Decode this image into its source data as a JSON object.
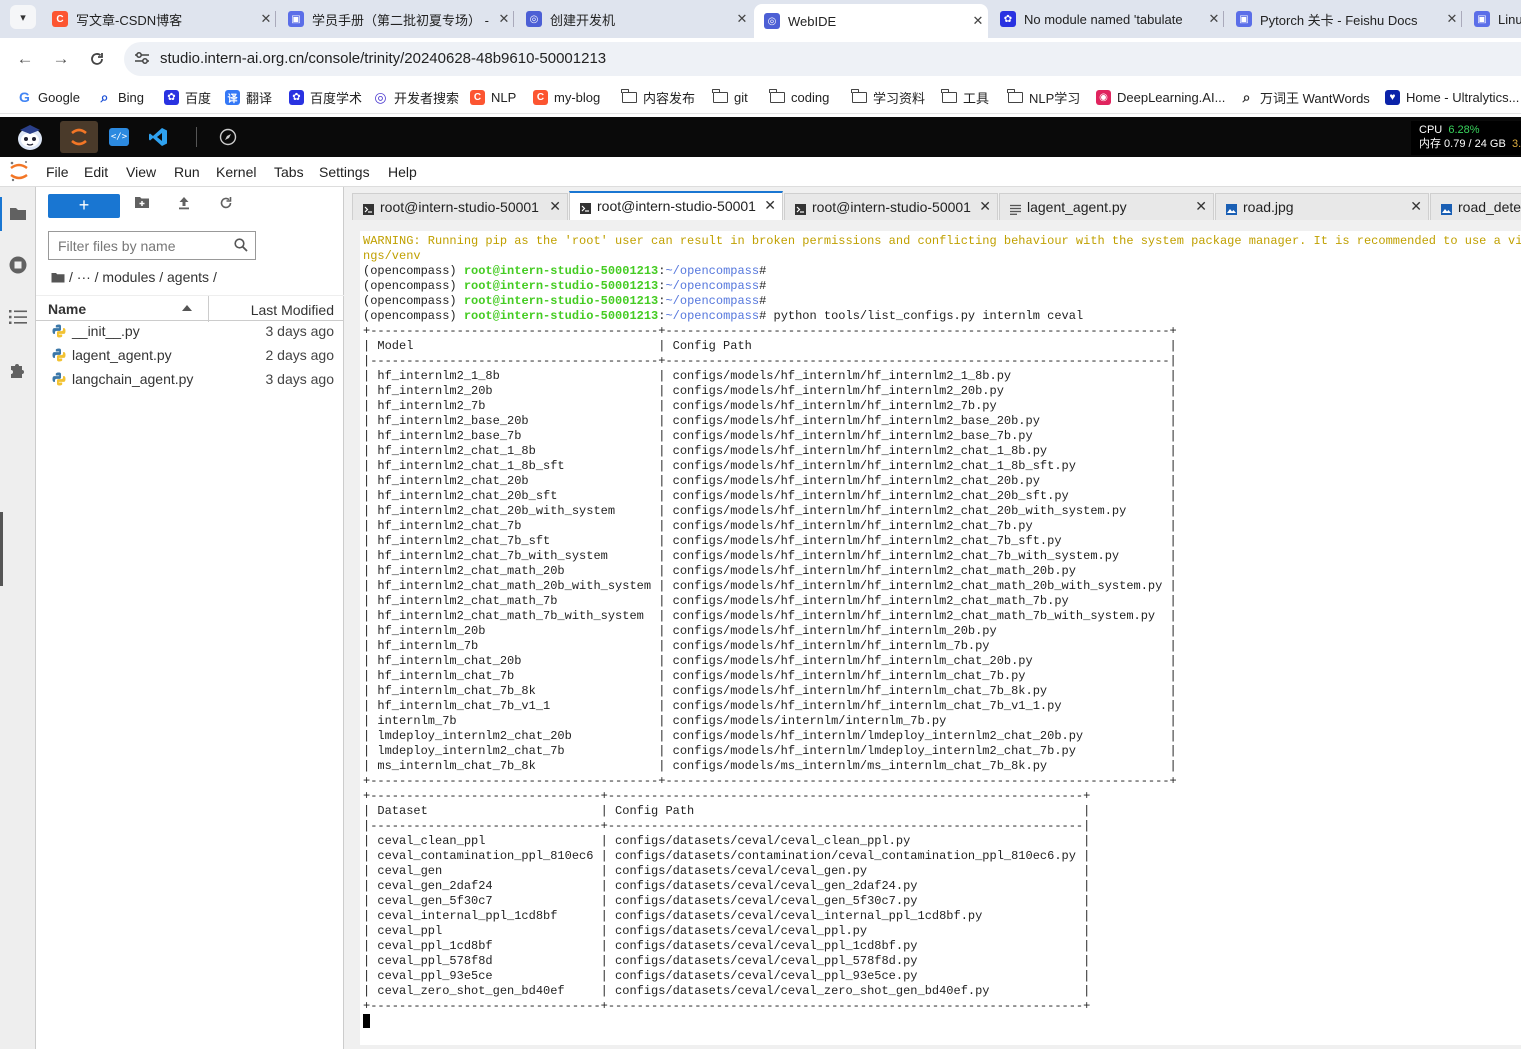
{
  "browser": {
    "tabs": [
      {
        "title": "写文章-CSDN博客",
        "icon": "csdn-icon",
        "color": "#fc5531",
        "letter": "C"
      },
      {
        "title": "学员手册（第二批初夏专场） - ",
        "icon": "feishu-doc-icon",
        "color": "#5b6ee8",
        "letter": "▣"
      },
      {
        "title": "创建开发机",
        "icon": "intern-icon",
        "color": "#4c5fd5",
        "letter": "◎"
      },
      {
        "title": "WebIDE",
        "icon": "intern-icon",
        "color": "#4c5fd5",
        "letter": "◎",
        "active": true
      },
      {
        "title": "No module named 'tabulate",
        "icon": "baidu-icon",
        "color": "#2932e1",
        "letter": "✿"
      },
      {
        "title": "Pytorch 关卡 - Feishu Docs",
        "icon": "feishu-doc-icon",
        "color": "#5b6ee8",
        "letter": "▣"
      },
      {
        "title": "Linu",
        "icon": "feishu-doc-icon",
        "color": "#5b6ee8",
        "letter": "▣"
      }
    ],
    "url": "studio.intern-ai.org.cn/console/trinity/20240628-48b9610-50001213",
    "bookmarks": [
      {
        "label": "Google",
        "type": "google"
      },
      {
        "label": "Bing",
        "type": "search"
      },
      {
        "label": "百度",
        "type": "baidu"
      },
      {
        "label": "翻译",
        "type": "translate"
      },
      {
        "label": "百度学术",
        "type": "baidu"
      },
      {
        "label": "开发者搜索",
        "type": "devsearch"
      },
      {
        "label": "NLP",
        "type": "csdn"
      },
      {
        "label": "my-blog",
        "type": "csdn"
      },
      {
        "label": "内容发布",
        "type": "folder"
      },
      {
        "label": "git",
        "type": "folder"
      },
      {
        "label": "coding",
        "type": "folder"
      },
      {
        "label": "学习资料",
        "type": "folder"
      },
      {
        "label": "工具",
        "type": "folder"
      },
      {
        "label": "NLP学习",
        "type": "folder"
      },
      {
        "label": "DeepLearning.AI...",
        "type": "dlai"
      },
      {
        "label": "万词王 WantWords",
        "type": "wantwords"
      },
      {
        "label": "Home - Ultralytics...",
        "type": "ultra"
      }
    ]
  },
  "ide": {
    "cpu_label": "CPU",
    "cpu_value": "6.28%",
    "mem_label": "内存 0.79 / 24 GB",
    "mem_extra": "3."
  },
  "menubar": [
    "File",
    "Edit",
    "View",
    "Run",
    "Kernel",
    "Tabs",
    "Settings",
    "Help"
  ],
  "filebrowser": {
    "new_label": "+",
    "filter_placeholder": "Filter files by name",
    "breadcrumb": "/  ···  / modules / agents /",
    "col_name": "Name",
    "col_modified": "Last Modified",
    "files": [
      {
        "name": "__init__.py",
        "modified": "3 days ago"
      },
      {
        "name": "lagent_agent.py",
        "modified": "2 days ago"
      },
      {
        "name": "langchain_agent.py",
        "modified": "3 days ago"
      }
    ]
  },
  "doctabs": [
    {
      "label": "root@intern-studio-50001",
      "kind": "terminal"
    },
    {
      "label": "root@intern-studio-50001",
      "kind": "terminal",
      "active": true
    },
    {
      "label": "root@intern-studio-50001",
      "kind": "terminal"
    },
    {
      "label": "lagent_agent.py",
      "kind": "file"
    },
    {
      "label": "road.jpg",
      "kind": "image"
    },
    {
      "label": "road_detec",
      "kind": "image"
    }
  ],
  "terminal": {
    "warning": "WARNING: Running pip as the 'root' user can result in broken permissions and conflicting behaviour with the system package manager. It is recommended to use a virtual",
    "warning_cont": "ngs/venv",
    "env": "(opencompass) ",
    "user": "root@intern-studio-50001213",
    "colon": ":",
    "path": "~/opencompass",
    "prompt_end": "#",
    "command": " python tools/list_configs.py internlm ceval",
    "model_header": [
      "Model",
      "Config Path"
    ],
    "models": [
      [
        "hf_internlm2_1_8b",
        "configs/models/hf_internlm/hf_internlm2_1_8b.py"
      ],
      [
        "hf_internlm2_20b",
        "configs/models/hf_internlm/hf_internlm2_20b.py"
      ],
      [
        "hf_internlm2_7b",
        "configs/models/hf_internlm/hf_internlm2_7b.py"
      ],
      [
        "hf_internlm2_base_20b",
        "configs/models/hf_internlm/hf_internlm2_base_20b.py"
      ],
      [
        "hf_internlm2_base_7b",
        "configs/models/hf_internlm/hf_internlm2_base_7b.py"
      ],
      [
        "hf_internlm2_chat_1_8b",
        "configs/models/hf_internlm/hf_internlm2_chat_1_8b.py"
      ],
      [
        "hf_internlm2_chat_1_8b_sft",
        "configs/models/hf_internlm/hf_internlm2_chat_1_8b_sft.py"
      ],
      [
        "hf_internlm2_chat_20b",
        "configs/models/hf_internlm/hf_internlm2_chat_20b.py"
      ],
      [
        "hf_internlm2_chat_20b_sft",
        "configs/models/hf_internlm/hf_internlm2_chat_20b_sft.py"
      ],
      [
        "hf_internlm2_chat_20b_with_system",
        "configs/models/hf_internlm/hf_internlm2_chat_20b_with_system.py"
      ],
      [
        "hf_internlm2_chat_7b",
        "configs/models/hf_internlm/hf_internlm2_chat_7b.py"
      ],
      [
        "hf_internlm2_chat_7b_sft",
        "configs/models/hf_internlm/hf_internlm2_chat_7b_sft.py"
      ],
      [
        "hf_internlm2_chat_7b_with_system",
        "configs/models/hf_internlm/hf_internlm2_chat_7b_with_system.py"
      ],
      [
        "hf_internlm2_chat_math_20b",
        "configs/models/hf_internlm/hf_internlm2_chat_math_20b.py"
      ],
      [
        "hf_internlm2_chat_math_20b_with_system",
        "configs/models/hf_internlm/hf_internlm2_chat_math_20b_with_system.py"
      ],
      [
        "hf_internlm2_chat_math_7b",
        "configs/models/hf_internlm/hf_internlm2_chat_math_7b.py"
      ],
      [
        "hf_internlm2_chat_math_7b_with_system",
        "configs/models/hf_internlm/hf_internlm2_chat_math_7b_with_system.py"
      ],
      [
        "hf_internlm_20b",
        "configs/models/hf_internlm/hf_internlm_20b.py"
      ],
      [
        "hf_internlm_7b",
        "configs/models/hf_internlm/hf_internlm_7b.py"
      ],
      [
        "hf_internlm_chat_20b",
        "configs/models/hf_internlm/hf_internlm_chat_20b.py"
      ],
      [
        "hf_internlm_chat_7b",
        "configs/models/hf_internlm/hf_internlm_chat_7b.py"
      ],
      [
        "hf_internlm_chat_7b_8k",
        "configs/models/hf_internlm/hf_internlm_chat_7b_8k.py"
      ],
      [
        "hf_internlm_chat_7b_v1_1",
        "configs/models/hf_internlm/hf_internlm_chat_7b_v1_1.py"
      ],
      [
        "internlm_7b",
        "configs/models/internlm/internlm_7b.py"
      ],
      [
        "lmdeploy_internlm2_chat_20b",
        "configs/models/hf_internlm/lmdeploy_internlm2_chat_20b.py"
      ],
      [
        "lmdeploy_internlm2_chat_7b",
        "configs/models/hf_internlm/lmdeploy_internlm2_chat_7b.py"
      ],
      [
        "ms_internlm_chat_7b_8k",
        "configs/models/ms_internlm/ms_internlm_chat_7b_8k.py"
      ]
    ],
    "dataset_header": [
      "Dataset",
      "Config Path"
    ],
    "datasets": [
      [
        "ceval_clean_ppl",
        "configs/datasets/ceval/ceval_clean_ppl.py"
      ],
      [
        "ceval_contamination_ppl_810ec6",
        "configs/datasets/contamination/ceval_contamination_ppl_810ec6.py"
      ],
      [
        "ceval_gen",
        "configs/datasets/ceval/ceval_gen.py"
      ],
      [
        "ceval_gen_2daf24",
        "configs/datasets/ceval/ceval_gen_2daf24.py"
      ],
      [
        "ceval_gen_5f30c7",
        "configs/datasets/ceval/ceval_gen_5f30c7.py"
      ],
      [
        "ceval_internal_ppl_1cd8bf",
        "configs/datasets/ceval/ceval_internal_ppl_1cd8bf.py"
      ],
      [
        "ceval_ppl",
        "configs/datasets/ceval/ceval_ppl.py"
      ],
      [
        "ceval_ppl_1cd8bf",
        "configs/datasets/ceval/ceval_ppl_1cd8bf.py"
      ],
      [
        "ceval_ppl_578f8d",
        "configs/datasets/ceval/ceval_ppl_578f8d.py"
      ],
      [
        "ceval_ppl_93e5ce",
        "configs/datasets/ceval/ceval_ppl_93e5ce.py"
      ],
      [
        "ceval_zero_shot_gen_bd40ef",
        "configs/datasets/ceval/ceval_zero_shot_gen_bd40ef.py"
      ]
    ]
  }
}
